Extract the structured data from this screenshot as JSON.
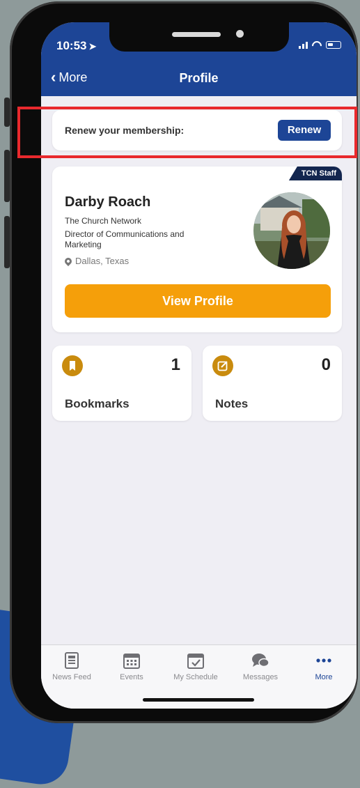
{
  "status_bar": {
    "time": "10:53"
  },
  "nav": {
    "back_label": "More",
    "title": "Profile"
  },
  "renew": {
    "text": "Renew your membership:",
    "button_label": "Renew"
  },
  "profile": {
    "tag": "TCN Staff",
    "name": "Darby Roach",
    "organization": "The Church Network",
    "role": "Director of Communications and Marketing",
    "location": "Dallas, Texas",
    "view_button": "View Profile"
  },
  "stats": {
    "bookmarks": {
      "label": "Bookmarks",
      "count": "1"
    },
    "notes": {
      "label": "Notes",
      "count": "0"
    }
  },
  "tabbar": {
    "items": [
      {
        "label": "News Feed",
        "icon": "news-feed-icon"
      },
      {
        "label": "Events",
        "icon": "calendar-icon"
      },
      {
        "label": "My Schedule",
        "icon": "calendar-check-icon"
      },
      {
        "label": "Messages",
        "icon": "chat-bubbles-icon"
      },
      {
        "label": "More",
        "icon": "ellipsis-icon"
      }
    ],
    "active": "More"
  },
  "colors": {
    "header": "#1d4596",
    "accent": "#f59f0a",
    "highlight": "#e8292d",
    "staff_tag": "#13264f"
  }
}
